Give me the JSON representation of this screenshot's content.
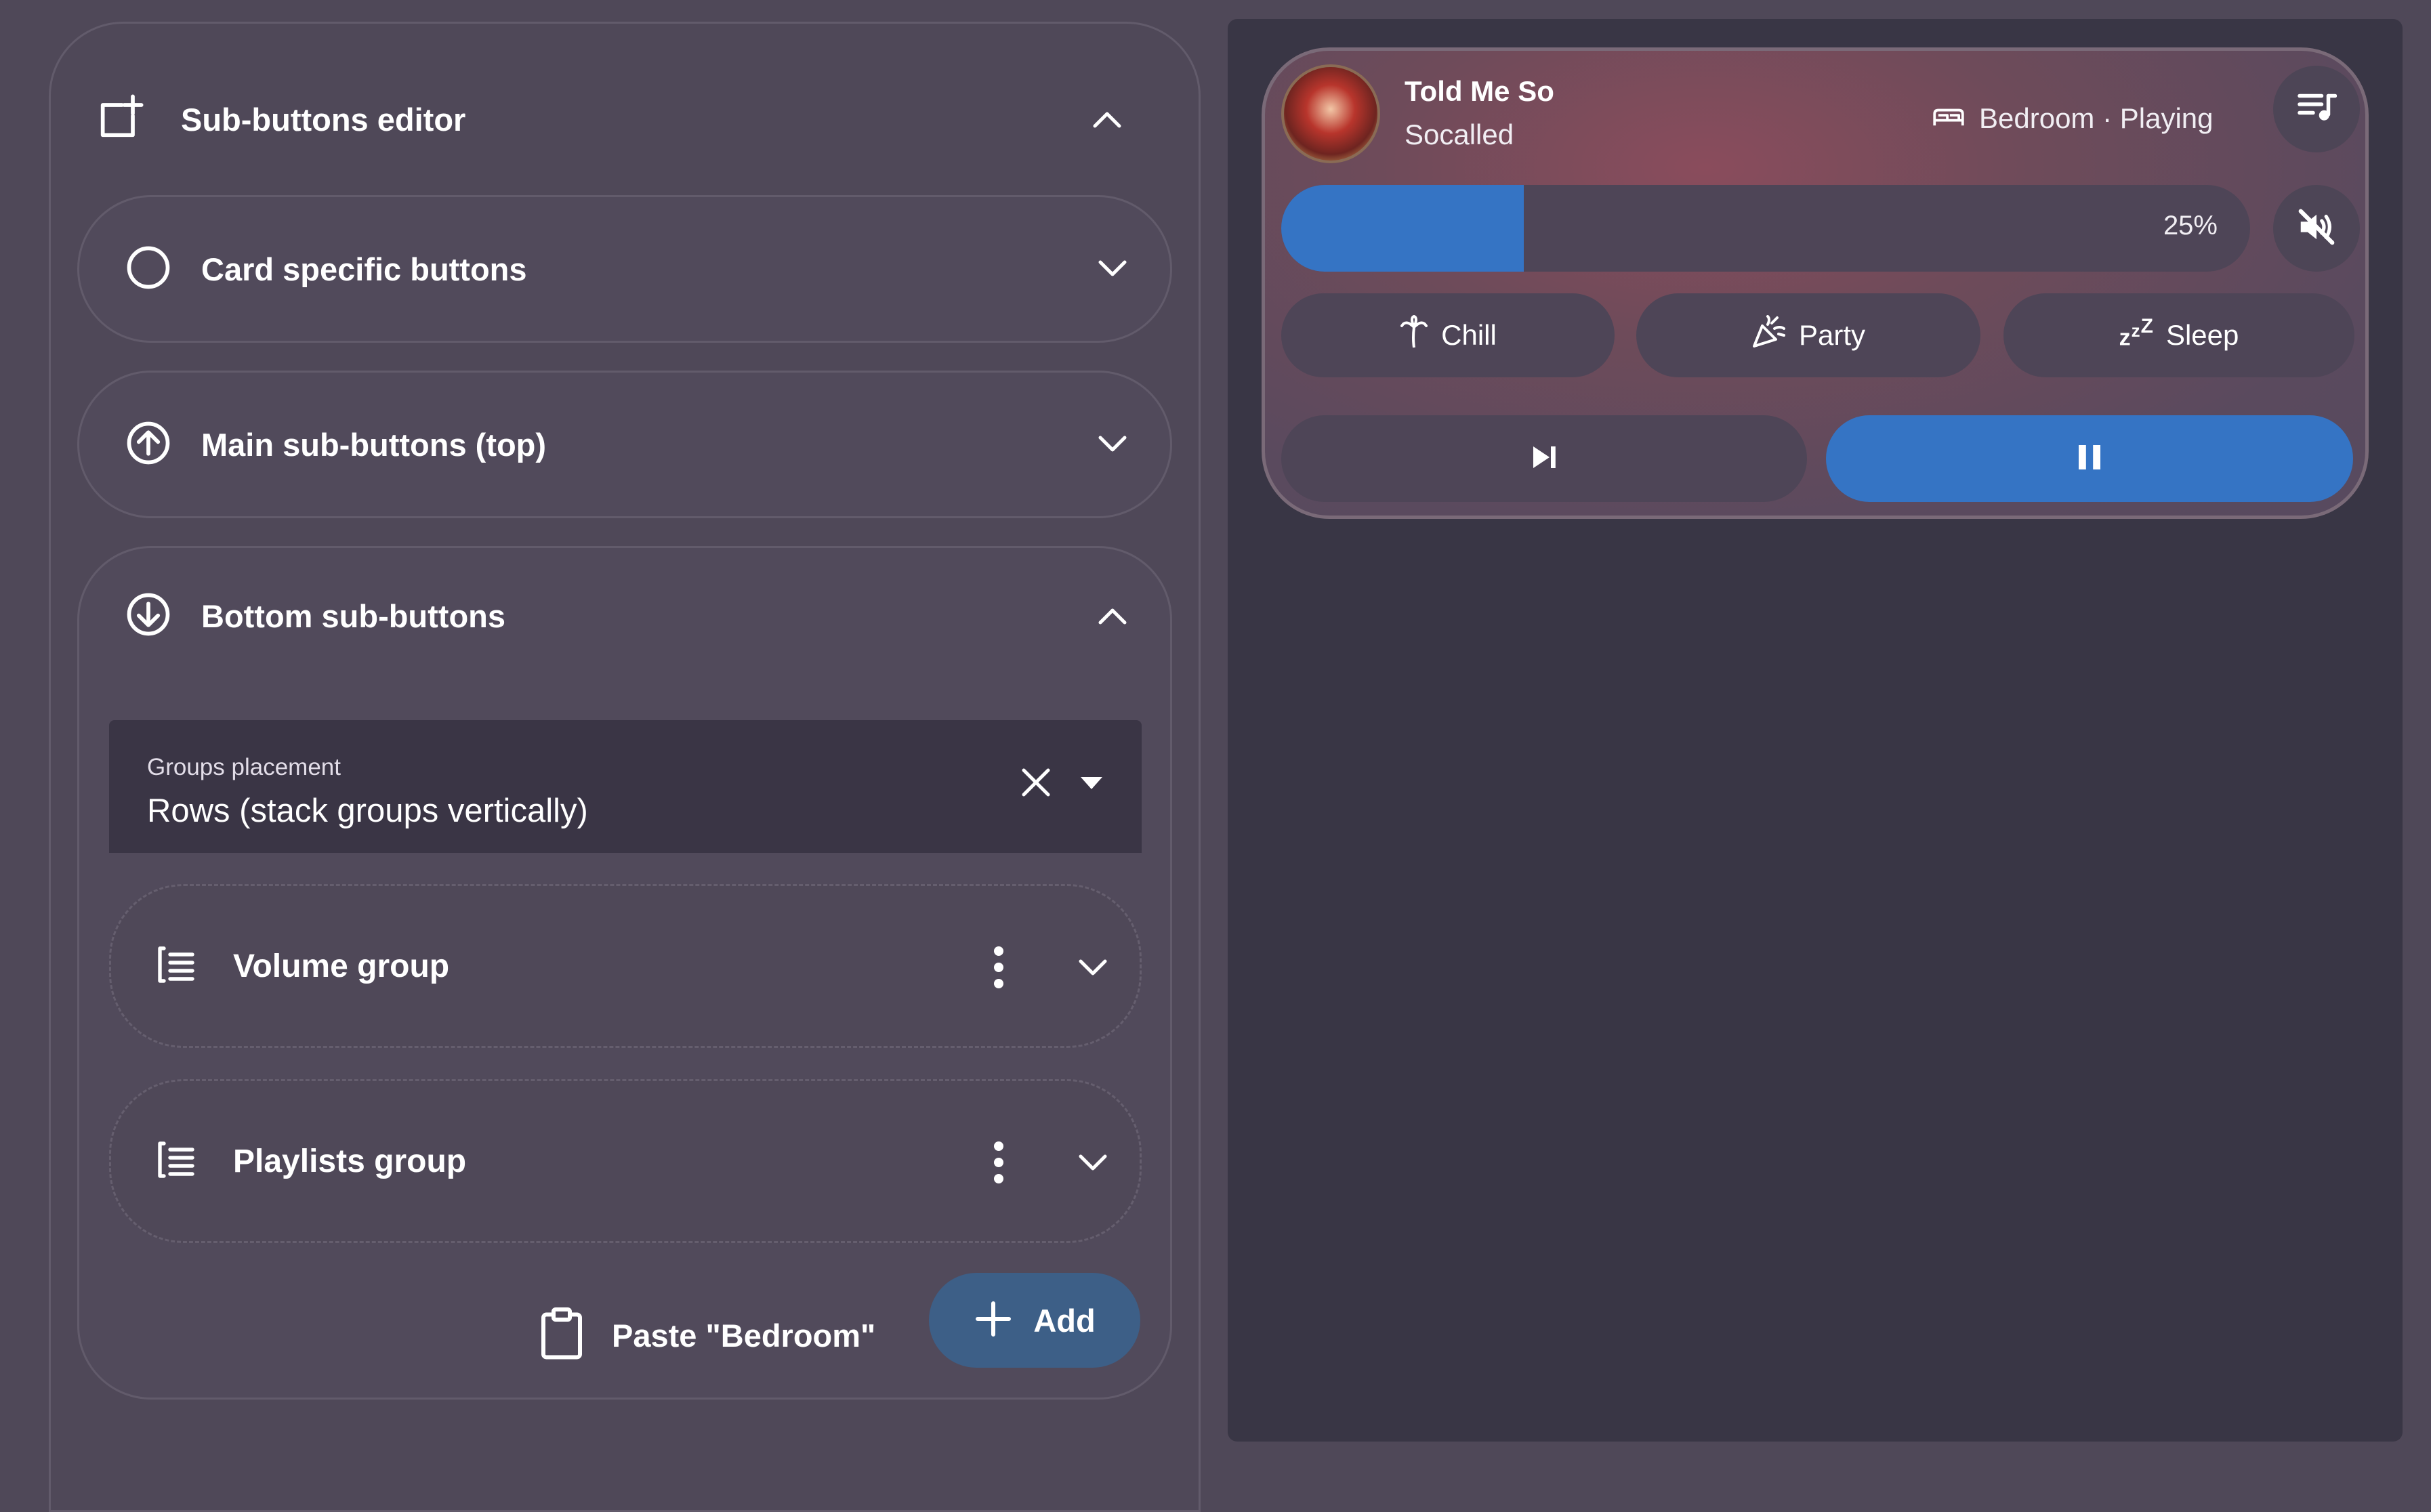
{
  "editor": {
    "title": "Sub-buttons editor",
    "header_icon": "add-box-outline-icon",
    "sections": {
      "card_specific": {
        "title": "Card specific buttons",
        "icon": "circle-outline-icon"
      },
      "main_top": {
        "title": "Main sub-buttons (top)",
        "icon": "arrow-up-circle-icon"
      },
      "bottom": {
        "title": "Bottom sub-buttons",
        "icon": "arrow-down-circle-icon",
        "groups_placement": {
          "label": "Groups placement",
          "value": "Rows (stack groups vertically)"
        },
        "groups": [
          {
            "title": "Volume group",
            "icon": "format-list-group-icon"
          },
          {
            "title": "Playlists group",
            "icon": "format-list-group-icon"
          }
        ],
        "paste_label": "Paste \"Bedroom\"",
        "add_label": "Add"
      }
    }
  },
  "preview": {
    "track_title": "Told Me So",
    "artist": "Socalled",
    "room_status": "Bedroom · Playing",
    "volume": {
      "value_label": "25%",
      "level": 0.25
    },
    "scenes": [
      {
        "label": "Chill",
        "icon": "palm-tree-icon"
      },
      {
        "label": "Party",
        "icon": "party-popper-icon"
      },
      {
        "label": "Sleep",
        "icon": "sleep-icon"
      }
    ],
    "colors": {
      "accent": "#3574c4",
      "add_button": "#3d5f87"
    }
  }
}
